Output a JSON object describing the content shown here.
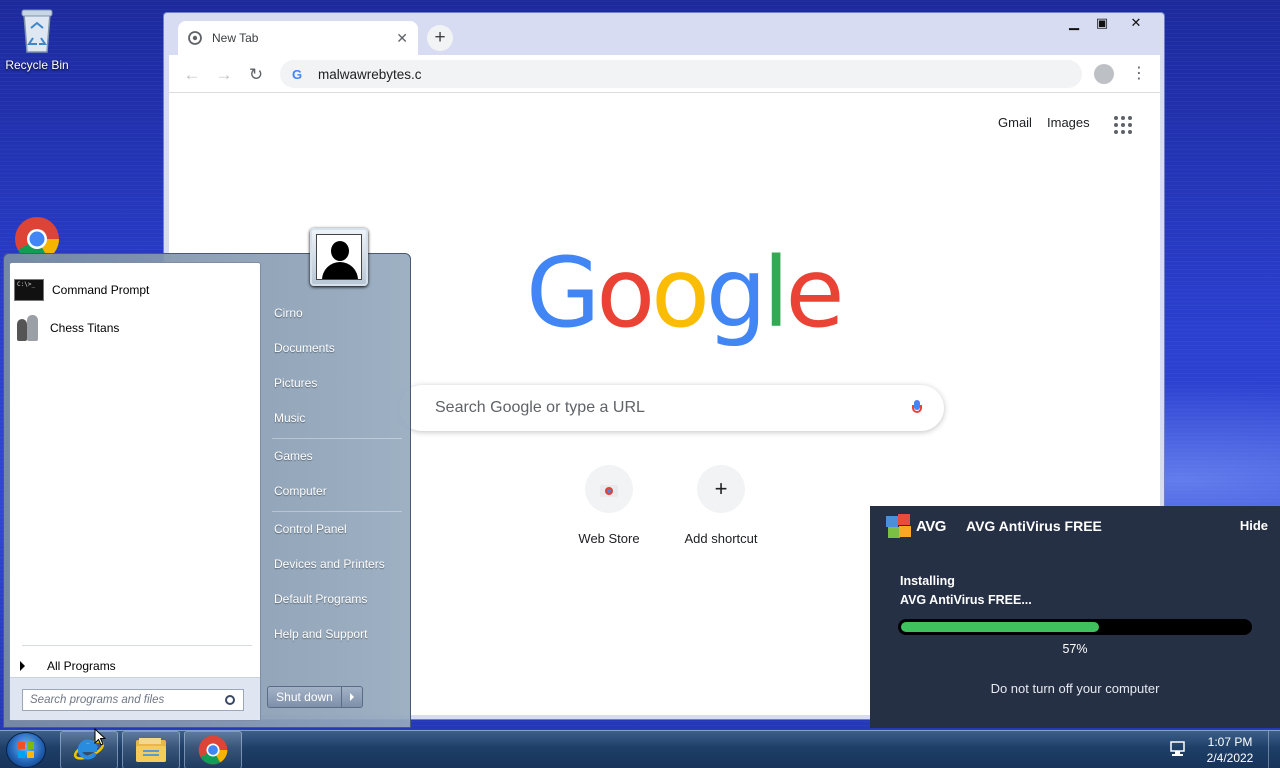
{
  "desktop": {
    "recycle_bin_label": "Recycle Bin"
  },
  "browser": {
    "tab_title": "New Tab",
    "new_tab_symbol": "+",
    "address_bar_value": "malwawrebytes.c",
    "top_links": [
      "Gmail",
      "Images"
    ],
    "search_placeholder": "Search Google or type a URL",
    "logo_letters": [
      {
        "char": "G",
        "color": "#4285f4"
      },
      {
        "char": "o",
        "color": "#ea4335"
      },
      {
        "char": "o",
        "color": "#fbbc05"
      },
      {
        "char": "g",
        "color": "#4285f4"
      },
      {
        "char": "l",
        "color": "#34a853"
      },
      {
        "char": "e",
        "color": "#ea4335"
      }
    ],
    "shortcuts": [
      "Web Store",
      "Add shortcut"
    ]
  },
  "start_menu": {
    "pinned": [
      "Command Prompt",
      "Chess Titans"
    ],
    "all_programs": "All Programs",
    "search_placeholder": "Search programs and files",
    "right_items": [
      "Cirno",
      "Documents",
      "Pictures",
      "Music",
      "Games",
      "Computer",
      "Control Panel",
      "Devices and Printers",
      "Default Programs",
      "Help and Support"
    ],
    "shutdown_label": "Shut down"
  },
  "avg_popup": {
    "logo_text": "AVG",
    "title": "AVG AntiVirus FREE",
    "hide_label": "Hide",
    "installing_line1": "Installing",
    "installing_line2": "AVG AntiVirus FREE...",
    "progress_fraction": 0.57,
    "progress_text": "57%",
    "warning": "Do not turn off your computer",
    "progress_color": "#3fc25d"
  },
  "taskbar": {
    "time": "1:07 PM",
    "date": "2/4/2022"
  }
}
